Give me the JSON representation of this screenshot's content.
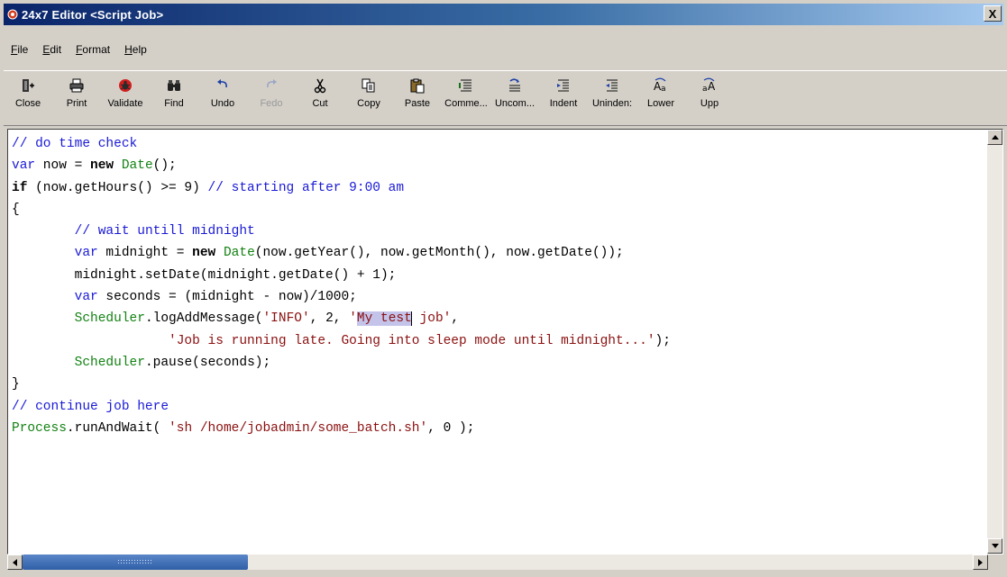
{
  "window": {
    "title": "24x7 Editor <Script Job>",
    "close_label": "X"
  },
  "menu": [
    {
      "label": "File"
    },
    {
      "label": "Edit"
    },
    {
      "label": "Format"
    },
    {
      "label": "Help"
    }
  ],
  "toolbar": [
    {
      "label": "Close",
      "icon": "close-doc-icon",
      "enabled": true
    },
    {
      "label": "Print",
      "icon": "printer-icon",
      "enabled": true
    },
    {
      "label": "Validate",
      "icon": "validate-bug-icon",
      "enabled": true
    },
    {
      "label": "Find",
      "icon": "binoculars-icon",
      "enabled": true
    },
    {
      "label": "Undo",
      "icon": "undo-icon",
      "enabled": true
    },
    {
      "label": "Fedo",
      "icon": "redo-icon",
      "enabled": false
    },
    {
      "label": "Cut",
      "icon": "scissors-icon",
      "enabled": true
    },
    {
      "label": "Copy",
      "icon": "copy-icon",
      "enabled": true
    },
    {
      "label": "Paste",
      "icon": "paste-icon",
      "enabled": true
    },
    {
      "label": "Comme...",
      "icon": "comment-icon",
      "enabled": true
    },
    {
      "label": "Uncom...",
      "icon": "uncomment-icon",
      "enabled": true
    },
    {
      "label": "Indent",
      "icon": "indent-icon",
      "enabled": true
    },
    {
      "label": "Uninden:",
      "icon": "unindent-icon",
      "enabled": true
    },
    {
      "label": "Lower",
      "icon": "lowercase-icon",
      "enabled": true
    },
    {
      "label": "Upp",
      "icon": "uppercase-icon",
      "enabled": true
    }
  ],
  "editor": {
    "lines": [
      [
        {
          "t": "// do time check",
          "c": "comment"
        }
      ],
      [
        {
          "t": "var",
          "c": "kw"
        },
        {
          "t": " now = ",
          "c": "plain"
        },
        {
          "t": "new",
          "c": "bold"
        },
        {
          "t": " ",
          "c": "plain"
        },
        {
          "t": "Date",
          "c": "obj"
        },
        {
          "t": "();",
          "c": "plain"
        }
      ],
      [
        {
          "t": "if",
          "c": "bold"
        },
        {
          "t": " (now.getHours() >= 9) ",
          "c": "plain"
        },
        {
          "t": "// starting after 9:00 am",
          "c": "comment"
        }
      ],
      [
        {
          "t": "{",
          "c": "plain"
        }
      ],
      [
        {
          "t": "        ",
          "c": "plain"
        },
        {
          "t": "// wait untill midnight",
          "c": "comment"
        }
      ],
      [
        {
          "t": "        ",
          "c": "plain"
        },
        {
          "t": "var",
          "c": "kw"
        },
        {
          "t": " midnight = ",
          "c": "plain"
        },
        {
          "t": "new",
          "c": "bold"
        },
        {
          "t": " ",
          "c": "plain"
        },
        {
          "t": "Date",
          "c": "obj"
        },
        {
          "t": "(now.getYear(), now.getMonth(), now.getDate());",
          "c": "plain"
        }
      ],
      [
        {
          "t": "        midnight.setDate(midnight.getDate() + 1);",
          "c": "plain"
        }
      ],
      [
        {
          "t": "        ",
          "c": "plain"
        },
        {
          "t": "var",
          "c": "kw"
        },
        {
          "t": " seconds = (midnight - now)/1000;",
          "c": "plain"
        }
      ],
      [
        {
          "t": "        ",
          "c": "plain"
        },
        {
          "t": "Scheduler",
          "c": "obj"
        },
        {
          "t": ".logAddMessage(",
          "c": "plain"
        },
        {
          "t": "'INFO'",
          "c": "str"
        },
        {
          "t": ", 2, ",
          "c": "plain"
        },
        {
          "t": "'",
          "c": "str"
        },
        {
          "t": "My test",
          "c": "str-sel"
        },
        {
          "t": " job'",
          "c": "str"
        },
        {
          "t": ",",
          "c": "plain"
        }
      ],
      [
        {
          "t": "                    ",
          "c": "plain"
        },
        {
          "t": "'Job is running late. Going into sleep mode until midnight...'",
          "c": "str"
        },
        {
          "t": ");",
          "c": "plain"
        }
      ],
      [
        {
          "t": "        ",
          "c": "plain"
        },
        {
          "t": "Scheduler",
          "c": "obj"
        },
        {
          "t": ".pause(seconds);",
          "c": "plain"
        }
      ],
      [
        {
          "t": "}",
          "c": "plain"
        }
      ],
      [
        {
          "t": "// continue job here",
          "c": "comment"
        }
      ],
      [
        {
          "t": "Process",
          "c": "obj"
        },
        {
          "t": ".runAndWait( ",
          "c": "plain"
        },
        {
          "t": "'sh /home/jobadmin/some_batch.sh'",
          "c": "str"
        },
        {
          "t": ", 0 );",
          "c": "plain"
        }
      ]
    ]
  },
  "colors": {
    "titlebar_start": "#0a246a",
    "comment": "#1a1ad6",
    "object": "#138213",
    "string": "#8b1010",
    "selection": "#c4c4ea"
  }
}
